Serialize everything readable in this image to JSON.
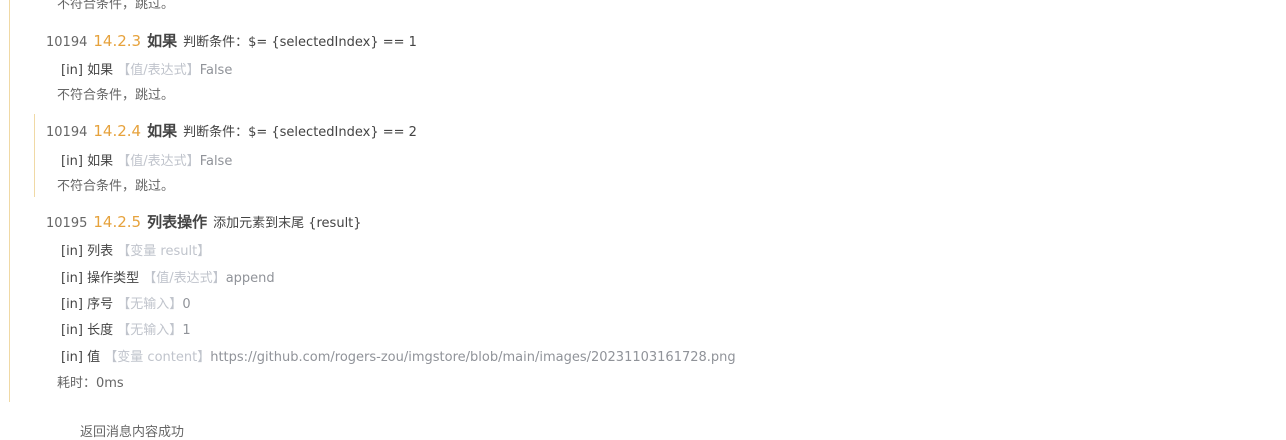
{
  "top_skip": "不符合条件，跳过。",
  "blocks": [
    {
      "line": "10194",
      "step": "14.2.3",
      "title": "如果",
      "desc": "判断条件：$= {selectedIndex} == 1",
      "params": [
        {
          "tag": "[in]",
          "name": "如果",
          "hint": "【值/表达式】",
          "value": "False"
        }
      ],
      "note": "不符合条件，跳过。"
    },
    {
      "line": "10194",
      "step": "14.2.4",
      "title": "如果",
      "desc": "判断条件：$= {selectedIndex} == 2",
      "params": [
        {
          "tag": "[in]",
          "name": "如果",
          "hint": "【值/表达式】",
          "value": "False"
        }
      ],
      "note": "不符合条件，跳过。"
    },
    {
      "line": "10195",
      "step": "14.2.5",
      "title": "列表操作",
      "desc": "添加元素到末尾 {result}",
      "params": [
        {
          "tag": "[in]",
          "name": "列表",
          "hint": "【变量 result】",
          "value": ""
        },
        {
          "tag": "[in]",
          "name": "操作类型",
          "hint": "【值/表达式】",
          "value": "append"
        },
        {
          "tag": "[in]",
          "name": "序号",
          "hint": "【无输入】",
          "value": "0"
        },
        {
          "tag": "[in]",
          "name": "长度",
          "hint": "【无输入】",
          "value": "1"
        },
        {
          "tag": "[in]",
          "name": "值",
          "hint": "【变量 content】",
          "value": "https://github.com/rogers-zou/imgstore/blob/main/images/20231103161728.png"
        }
      ],
      "note": "耗时：0ms"
    }
  ],
  "bottom_text": "返回消息内容成功"
}
